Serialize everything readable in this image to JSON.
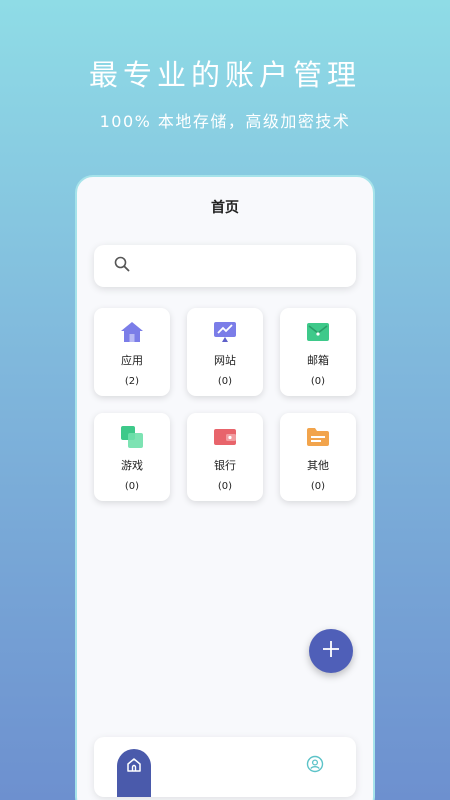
{
  "hero": {
    "title": "最专业的账户管理",
    "subtitle": "100% 本地存储，高级加密技术"
  },
  "screen": {
    "title": "首页",
    "search": {
      "icon": "search-icon"
    },
    "categories": [
      {
        "label": "应用",
        "count": "(2)",
        "icon": "home-icon",
        "color": "#7b7de8"
      },
      {
        "label": "网站",
        "count": "(0)",
        "icon": "monitor-chart-icon",
        "color": "#7b7de8"
      },
      {
        "label": "邮箱",
        "count": "(0)",
        "icon": "envelope-icon",
        "color": "#3ec98a"
      },
      {
        "label": "游戏",
        "count": "(0)",
        "icon": "game-squares-icon",
        "color": "#3ec98a"
      },
      {
        "label": "银行",
        "count": "(0)",
        "icon": "wallet-icon",
        "color": "#e8646b"
      },
      {
        "label": "其他",
        "count": "(0)",
        "icon": "folder-icon",
        "color": "#f2a44c"
      }
    ],
    "fab": {
      "icon": "plus-icon"
    },
    "tabbar": {
      "tabs": [
        {
          "icon": "home-tab-icon",
          "active": true
        },
        {
          "icon": "profile-icon",
          "active": false
        }
      ]
    }
  },
  "colors": {
    "accent": "#4f5fb8",
    "active_tab": "#4a5aab"
  }
}
